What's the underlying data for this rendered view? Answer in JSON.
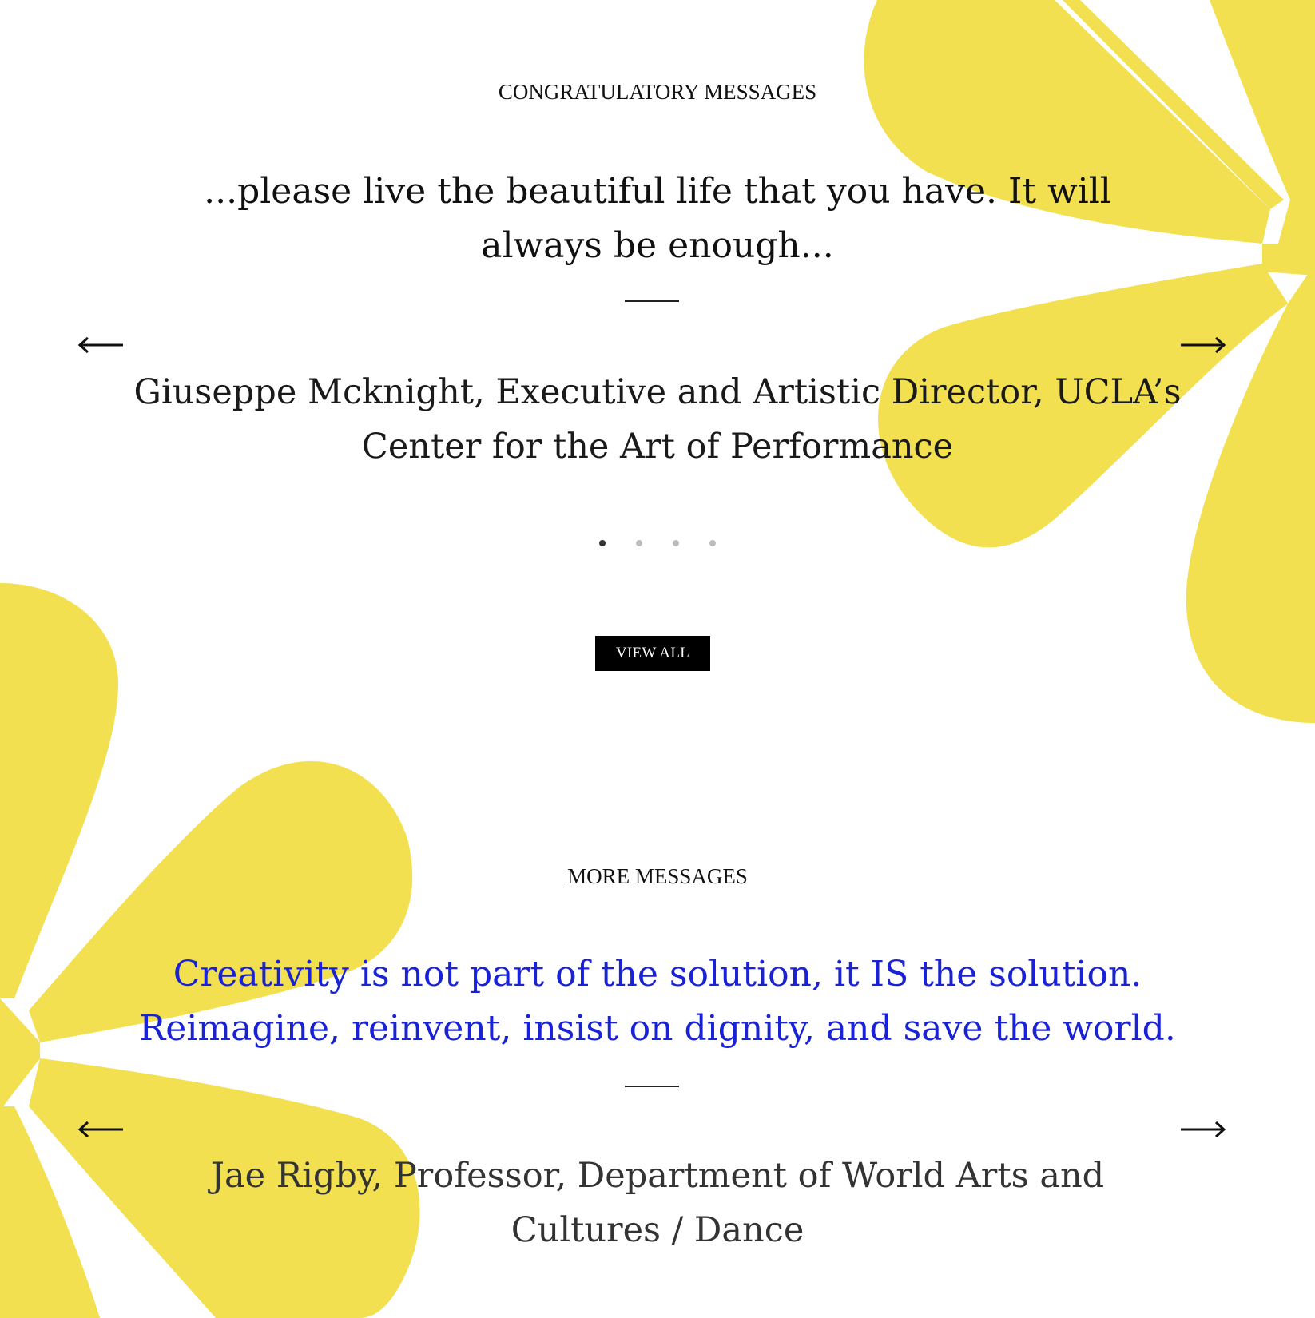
{
  "colors": {
    "flower": "#f2e050",
    "quote_blue": "#1a22d6",
    "button_bg": "#000000",
    "dot_active": "#333333",
    "dot_inactive": "#bdbdbd"
  },
  "congratulatory": {
    "heading": "CONGRATULATORY MESSAGES",
    "quote": "...please live the beautiful life that you have. It will always be enough...",
    "attribution": "Giuseppe Mcknight, Executive and Artistic Director, UCLA’s Center for the Art of Performance",
    "prev_icon": "arrow-left-icon",
    "next_icon": "arrow-right-icon",
    "slide_count": 4,
    "active_slide": 1,
    "view_all_label": "VIEW ALL"
  },
  "more": {
    "heading": "MORE MESSAGES",
    "quote": "Creativity is not part of the solution, it IS the solution. Reimagine, reinvent, insist on dignity, and save the world.",
    "attribution": "Jae Rigby, Professor, Department of World Arts and Cultures / Dance",
    "prev_icon": "arrow-left-icon",
    "next_icon": "arrow-right-icon"
  }
}
